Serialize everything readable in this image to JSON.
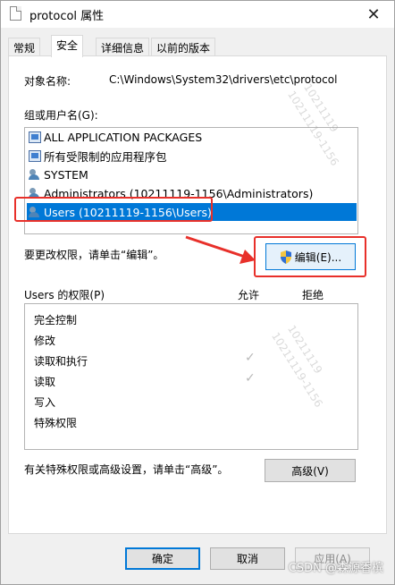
{
  "titlebar": {
    "title": "protocol 属性",
    "close_glyph": "✕"
  },
  "tabs": [
    {
      "label": "常规",
      "active": false
    },
    {
      "label": "安全",
      "active": true
    },
    {
      "label": "详细信息",
      "active": false
    },
    {
      "label": "以前的版本",
      "active": false
    }
  ],
  "object": {
    "label": "对象名称:",
    "value": "C:\\Windows\\System32\\drivers\\etc\\protocol"
  },
  "groups": {
    "label": "组或用户名(G):",
    "items": [
      {
        "name": "ALL APPLICATION PACKAGES",
        "icon": "package-icon"
      },
      {
        "name": "所有受限制的应用程序包",
        "icon": "package-icon"
      },
      {
        "name": "SYSTEM",
        "icon": "users-icon"
      },
      {
        "name": "Administrators (10211119-1156\\Administrators)",
        "icon": "users-icon"
      },
      {
        "name": "Users (10211119-1156\\Users)",
        "icon": "users-icon",
        "selected": true
      }
    ]
  },
  "change_hint": "要更改权限，请单击“编辑”。",
  "edit_button": "编辑(E)...",
  "permissions": {
    "label": "Users 的权限(P)",
    "allow_header": "允许",
    "deny_header": "拒绝",
    "rows": [
      {
        "name": "完全控制",
        "allow": false
      },
      {
        "name": "修改",
        "allow": false
      },
      {
        "name": "读取和执行",
        "allow": true
      },
      {
        "name": "读取",
        "allow": true
      },
      {
        "name": "写入",
        "allow": false
      },
      {
        "name": "特殊权限",
        "allow": false
      }
    ]
  },
  "advanced_hint": "有关特殊权限或高级设置，请单击“高级”。",
  "advanced_button": "高级(V)",
  "footer": {
    "ok": "确定",
    "cancel": "取消",
    "apply": "应用(A)"
  },
  "watermark": {
    "line1": "10211119",
    "line2": "10211119-1156"
  },
  "credit": "CSDN @森源香槟",
  "colors": {
    "selection": "#0078d7",
    "annotation": "#e8302a"
  }
}
